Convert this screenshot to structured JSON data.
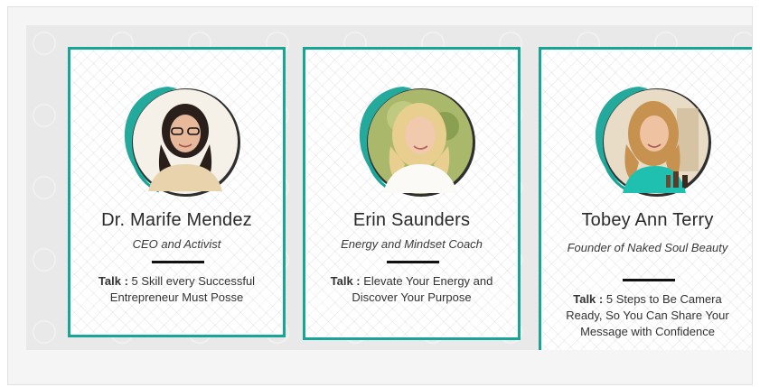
{
  "colors": {
    "accent": "#17a597",
    "text": "#2a2a2a",
    "band": "#e9e9e9",
    "frame": "#f5f5f5"
  },
  "speakers": [
    {
      "name": "Dr. Marife Mendez",
      "role": "CEO and Activist",
      "talk_label": "Talk :",
      "talk": " 5 Skill every Successful Entrepreneur Must Posse"
    },
    {
      "name": "Erin Saunders",
      "role": "Energy and Mindset Coach",
      "talk_label": "Talk :",
      "talk": " Elevate Your Energy and Discover Your Purpose"
    },
    {
      "name": "Tobey Ann Terry",
      "role": "Founder of Naked Soul Beauty",
      "talk_label": "Talk :",
      "talk": " 5 Steps to Be Camera Ready, So You Can Share Your Message with Confidence"
    }
  ]
}
